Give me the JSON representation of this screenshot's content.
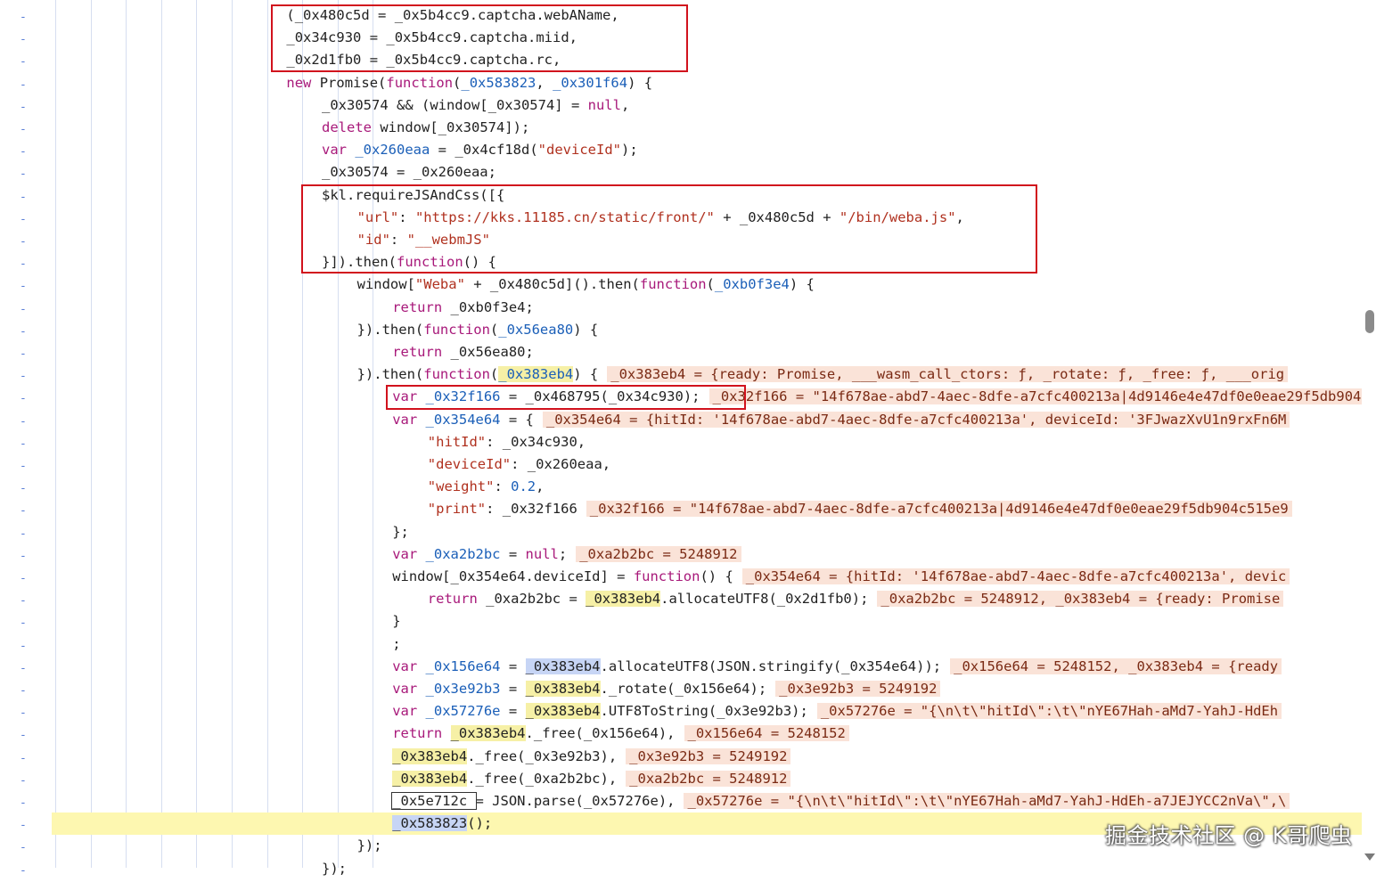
{
  "editor": {
    "gutter_marker": "-",
    "lines": [
      {
        "tokens": [
          [
            "(_0x480c5d = _0x5b4cc9.captcha.webAName,",
            "id"
          ]
        ]
      },
      {
        "tokens": [
          [
            "_0x34c930 = _0x5b4cc9.captcha.miid,",
            "id"
          ]
        ]
      },
      {
        "tokens": [
          [
            "_0x2d1fb0 = _0x5b4cc9.captcha.rc,",
            "id"
          ]
        ]
      },
      {
        "tokens": [
          [
            "new",
            "kw"
          ],
          [
            " Promise(",
            "id"
          ],
          [
            "function",
            "fn"
          ],
          [
            "(",
            "id"
          ],
          [
            "_0x583823",
            "pm"
          ],
          [
            ", ",
            "id"
          ],
          [
            "_0x301f64",
            "pm"
          ],
          [
            ") {",
            "id"
          ]
        ]
      },
      {
        "tokens": [
          [
            "_0x30574 && (window[_0x30574] = ",
            "id"
          ],
          [
            "null",
            "kw"
          ],
          [
            ",",
            "id"
          ]
        ]
      },
      {
        "tokens": [
          [
            "delete",
            "kw"
          ],
          [
            " window[_0x30574]);",
            "id"
          ]
        ]
      },
      {
        "tokens": [
          [
            "var",
            "kw"
          ],
          [
            " ",
            "id"
          ],
          [
            "_0x260eaa",
            "pm"
          ],
          [
            " = _0x4cf18d(",
            "id"
          ],
          [
            "\"deviceId\"",
            "st"
          ],
          [
            ");",
            "id"
          ]
        ]
      },
      {
        "tokens": [
          [
            "_0x30574 = _0x260eaa;",
            "id"
          ]
        ]
      },
      {
        "tokens": [
          [
            "$kl.requireJSAndCss([{",
            "id"
          ]
        ]
      },
      {
        "tokens": [
          [
            "\"url\"",
            "st"
          ],
          [
            ": ",
            "id"
          ],
          [
            "\"https://kks.11185.cn/static/front/\"",
            "st"
          ],
          [
            " + _0x480c5d + ",
            "id"
          ],
          [
            "\"/bin/weba.js\"",
            "st"
          ],
          [
            ",",
            "id"
          ]
        ]
      },
      {
        "tokens": [
          [
            "\"id\"",
            "st"
          ],
          [
            ": ",
            "id"
          ],
          [
            "\"__webmJS\"",
            "st"
          ]
        ]
      },
      {
        "tokens": [
          [
            "}]).then(",
            "id"
          ],
          [
            "function",
            "fn"
          ],
          [
            "() {",
            "id"
          ]
        ]
      },
      {
        "tokens": [
          [
            "window[",
            "id"
          ],
          [
            "\"Weba\"",
            "st"
          ],
          [
            " + _0x480c5d]().then(",
            "id"
          ],
          [
            "function",
            "fn"
          ],
          [
            "(",
            "id"
          ],
          [
            "_0xb0f3e4",
            "pm"
          ],
          [
            ") {",
            "id"
          ]
        ]
      },
      {
        "tokens": [
          [
            "return",
            "kw"
          ],
          [
            " _0xb0f3e4;",
            "id"
          ]
        ]
      },
      {
        "tokens": [
          [
            "}).then(",
            "id"
          ],
          [
            "function",
            "fn"
          ],
          [
            "(",
            "id"
          ],
          [
            "_0x56ea80",
            "pm"
          ],
          [
            ") {",
            "id"
          ]
        ]
      },
      {
        "tokens": [
          [
            "return",
            "kw"
          ],
          [
            " _0x56ea80;",
            "id"
          ]
        ]
      },
      {
        "tokens": [
          [
            "}).then(",
            "id"
          ],
          [
            "function",
            "fn"
          ],
          [
            "(",
            "id"
          ],
          [
            "_0x383eb4",
            "pm yhl"
          ],
          [
            ") {",
            "id"
          ]
        ],
        "inline": "_0x383eb4 = {ready: Promise, ___wasm_call_ctors: ƒ, _rotate: ƒ, _free: ƒ, ___orig"
      },
      {
        "tokens": [
          [
            "var",
            "kw"
          ],
          [
            " ",
            "id"
          ],
          [
            "_0x32f166",
            "pm"
          ],
          [
            " = _0x468795(_0x34c930);",
            "id"
          ]
        ],
        "inline": "_0x32f166 = \"14f678ae-abd7-4aec-8dfe-a7cfc400213a|4d9146e4e47df0e0eae29f5db904c515e9"
      },
      {
        "tokens": [
          [
            "var",
            "kw"
          ],
          [
            " ",
            "id"
          ],
          [
            "_0x354e64",
            "pm"
          ],
          [
            " = {",
            "id"
          ]
        ],
        "inline": "_0x354e64 = {hitId: '14f678ae-abd7-4aec-8dfe-a7cfc400213a', deviceId: '3FJwazXvU1n9rxFn6M"
      },
      {
        "tokens": [
          [
            "\"hitId\"",
            "st"
          ],
          [
            ": _0x34c930,",
            "id"
          ]
        ]
      },
      {
        "tokens": [
          [
            "\"deviceId\"",
            "st"
          ],
          [
            ": _0x260eaa,",
            "id"
          ]
        ]
      },
      {
        "tokens": [
          [
            "\"weight\"",
            "st"
          ],
          [
            ": ",
            "id"
          ],
          [
            "0.2",
            "nu"
          ],
          [
            ",",
            "id"
          ]
        ]
      },
      {
        "tokens": [
          [
            "\"print\"",
            "st"
          ],
          [
            ": _0x32f166",
            "id"
          ]
        ],
        "inline": "_0x32f166 = \"14f678ae-abd7-4aec-8dfe-a7cfc400213a|4d9146e4e47df0e0eae29f5db904c515e9"
      },
      {
        "tokens": [
          [
            "};",
            "id"
          ]
        ]
      },
      {
        "tokens": [
          [
            "var",
            "kw"
          ],
          [
            " ",
            "id"
          ],
          [
            "_0xa2b2bc",
            "pm"
          ],
          [
            " = ",
            "id"
          ],
          [
            "null",
            "kw"
          ],
          [
            ";",
            "id"
          ]
        ],
        "inline": "_0xa2b2bc = 5248912"
      },
      {
        "tokens": [
          [
            "window[_0x354e64.deviceId] = ",
            "id"
          ],
          [
            "function",
            "fn"
          ],
          [
            "() {",
            "id"
          ]
        ],
        "inline": "_0x354e64 = {hitId: '14f678ae-abd7-4aec-8dfe-a7cfc400213a', devic"
      },
      {
        "tokens": [
          [
            "return",
            "kw"
          ],
          [
            " _0xa2b2bc = ",
            "id"
          ],
          [
            "_0x383eb4",
            "yhl"
          ],
          [
            ".allocateUTF8(_0x2d1fb0);",
            "id"
          ]
        ],
        "inline": "_0xa2b2bc = 5248912, _0x383eb4 = {ready: Promise"
      },
      {
        "tokens": [
          [
            "}",
            "id"
          ]
        ]
      },
      {
        "tokens": [
          [
            ";",
            "id"
          ]
        ]
      },
      {
        "tokens": [
          [
            "var",
            "kw"
          ],
          [
            " ",
            "id"
          ],
          [
            "_0x156e64",
            "pm"
          ],
          [
            " = ",
            "id"
          ],
          [
            "_0x383eb4",
            "bhl"
          ],
          [
            ".allocateUTF8(JSON.stringify(_0x354e64));",
            "id"
          ]
        ],
        "inline": "_0x156e64 = 5248152, _0x383eb4 = {ready"
      },
      {
        "tokens": [
          [
            "var",
            "kw"
          ],
          [
            " ",
            "id"
          ],
          [
            "_0x3e92b3",
            "pm"
          ],
          [
            " = ",
            "id"
          ],
          [
            "_0x383eb4",
            "yhl"
          ],
          [
            "._rotate(_0x156e64);",
            "id"
          ]
        ],
        "inline": "_0x3e92b3 = 5249192"
      },
      {
        "tokens": [
          [
            "var",
            "kw"
          ],
          [
            " ",
            "id"
          ],
          [
            "_0x57276e",
            "pm"
          ],
          [
            " = ",
            "id"
          ],
          [
            "_0x383eb4",
            "yhl"
          ],
          [
            ".UTF8ToString(_0x3e92b3);",
            "id"
          ]
        ],
        "inline": "_0x57276e = \"{\\n\\t\\\"hitId\\\":\\t\\\"nYE67Hah-aMd7-YahJ-HdEh"
      },
      {
        "tokens": [
          [
            "return",
            "kw"
          ],
          [
            " ",
            "id"
          ],
          [
            "_0x383eb4",
            "yhl"
          ],
          [
            "._free(_0x156e64),",
            "id"
          ]
        ],
        "inline": "_0x156e64 = 5248152"
      },
      {
        "tokens": [
          [
            "_0x383eb4",
            "yhl"
          ],
          [
            "._free(_0x3e92b3),",
            "id"
          ]
        ],
        "inline": "_0x3e92b3 = 5249192"
      },
      {
        "tokens": [
          [
            "_0x383eb4",
            "yhl"
          ],
          [
            "._free(_0xa2b2bc),",
            "id"
          ]
        ],
        "inline": "_0xa2b2bc = 5248912"
      },
      {
        "tokens": [
          [
            "_0x5e712c ",
            "box"
          ],
          [
            "= JSON.parse(_0x57276e),",
            "id"
          ]
        ],
        "inline": "_0x57276e = \"{\\n\\t\\\"hitId\\\":\\t\\\"nYE67Hah-aMd7-YahJ-HdEh-a7JEJYCC2nVa\\\",\\"
      },
      {
        "tokens": [
          [
            "_0x583823",
            "bhl"
          ],
          [
            "();",
            "id"
          ]
        ],
        "current": true
      },
      {
        "tokens": [
          [
            "});",
            "id"
          ]
        ]
      },
      {
        "tokens": [
          [
            "});",
            "id"
          ]
        ]
      }
    ],
    "indents": [
      7,
      7,
      7,
      7,
      8,
      8,
      8,
      8,
      8,
      9,
      9,
      8,
      9,
      10,
      9,
      10,
      9,
      10,
      10,
      11,
      11,
      11,
      11,
      10,
      10,
      10,
      11,
      10,
      10,
      10,
      10,
      10,
      10,
      10,
      10,
      10,
      10,
      9,
      8
    ]
  },
  "watermark": "掘金技术社区 @ K哥爬虫"
}
